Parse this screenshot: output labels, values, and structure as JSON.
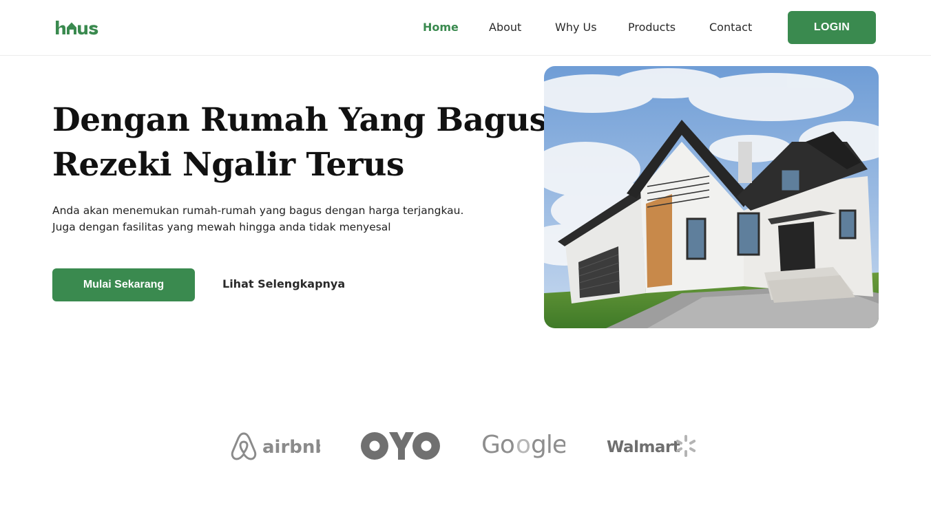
{
  "brand": {
    "name": "haus",
    "accent_color": "#3a8a4f"
  },
  "nav": {
    "items": [
      {
        "label": "Home",
        "active": true
      },
      {
        "label": "About",
        "active": false
      },
      {
        "label": "Why Us",
        "active": false
      },
      {
        "label": "Products",
        "active": false
      },
      {
        "label": "Contact",
        "active": false
      }
    ],
    "login_label": "LOGIN"
  },
  "hero": {
    "title_line1": "Dengan Rumah Yang Bagus",
    "title_line2": "Rezeki Ngalir Terus",
    "description_line1": "Anda akan menemukan rumah-rumah yang bagus dengan harga terjangkau.",
    "description_line2": "Juga dengan fasilitas yang mewah hingga anda tidak menyesal",
    "primary_cta": "Mulai Sekarang",
    "secondary_cta": "Lihat Selengkapnya",
    "image_subject": "modern-house-photo"
  },
  "partners": {
    "logos": [
      {
        "name": "airbnb",
        "icon": "airbnb-logo"
      },
      {
        "name": "OYO",
        "icon": "oyo-logo"
      },
      {
        "name": "Google",
        "icon": "google-logo"
      },
      {
        "name": "Walmart",
        "icon": "walmart-logo"
      }
    ]
  }
}
